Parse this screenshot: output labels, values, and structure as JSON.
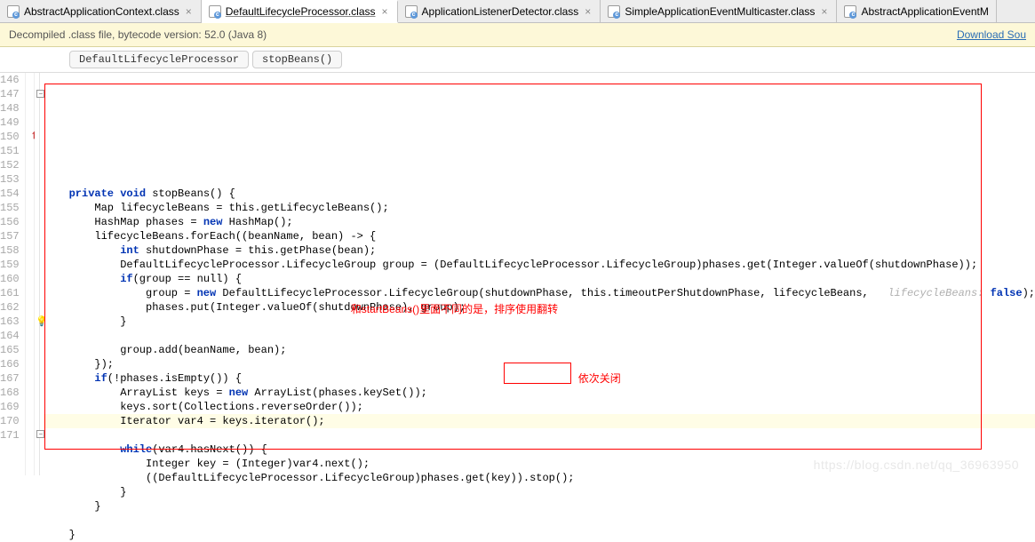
{
  "tabs": [
    {
      "label": "AbstractApplicationContext.class",
      "active": false
    },
    {
      "label": "DefaultLifecycleProcessor.class",
      "active": true
    },
    {
      "label": "ApplicationListenerDetector.class",
      "active": false
    },
    {
      "label": "SimpleApplicationEventMulticaster.class",
      "active": false
    },
    {
      "label": "AbstractApplicationEventM",
      "active": false,
      "truncated": true
    }
  ],
  "infoBar": {
    "text": "Decompiled .class file, bytecode version: 52.0 (Java 8)",
    "link": "Download Sou"
  },
  "breadcrumbs": {
    "class": "DefaultLifecycleProcessor",
    "method": "stopBeans()"
  },
  "lineStart": 146,
  "lineEnd": 171,
  "code": {
    "l147": {
      "indent": "    ",
      "k1": "private",
      "k2": "void",
      "rest": " stopBeans() {"
    },
    "l148": "        Map lifecycleBeans = this.getLifecycleBeans();",
    "l149": {
      "pre": "        HashMap phases = ",
      "kw": "new",
      "post": " HashMap();"
    },
    "l150": "        lifecycleBeans.forEach((beanName, bean) -> {",
    "l151": {
      "pre": "            ",
      "kw": "int",
      "post": " shutdownPhase = this.getPhase(bean);"
    },
    "l152": "            DefaultLifecycleProcessor.LifecycleGroup group = (DefaultLifecycleProcessor.LifecycleGroup)phases.get(Integer.valueOf(shutdownPhase));",
    "l153": {
      "pre": "            ",
      "kw": "if",
      "post": "(group == null) {"
    },
    "l154": {
      "pre": "                group = ",
      "kw": "new",
      "mid": " DefaultLifecycleProcessor.LifecycleGroup(shutdownPhase, this.timeoutPerShutdownPhase, lifecycleBeans, ",
      "hint": "  lifecycleBeans: ",
      "kw2": "false",
      "post": ");"
    },
    "l155": "                phases.put(Integer.valueOf(shutdownPhase), group);",
    "l156": "            }",
    "l157": "",
    "l158": "            group.add(beanName, bean);",
    "l159": "        });",
    "l160": {
      "pre": "        ",
      "kw": "if",
      "post": "(!phases.isEmpty()) {"
    },
    "l161": {
      "pre": "            ArrayList keys = ",
      "kw": "new",
      "post": " ArrayList(phases.keySet());"
    },
    "l162": "            keys.sort(Collections.reverseOrder());",
    "l163": "            Iterator var4 = keys.iterator();",
    "l164": "",
    "l165": {
      "pre": "            ",
      "kw": "while",
      "post": "(var4.hasNext()) {"
    },
    "l166": "                Integer key = (Integer)var4.next();",
    "l167": "                ((DefaultLifecycleProcessor.LifecycleGroup)phases.get(key)).stop();",
    "l168": "            }",
    "l169": "        }",
    "l170": "",
    "l171": "    }"
  },
  "annotations": {
    "line162": "和startBeans()里面不同的是，排序使用翻转",
    "line167": "依次关闭"
  },
  "watermark": "https://blog.csdn.net/qq_36963950"
}
